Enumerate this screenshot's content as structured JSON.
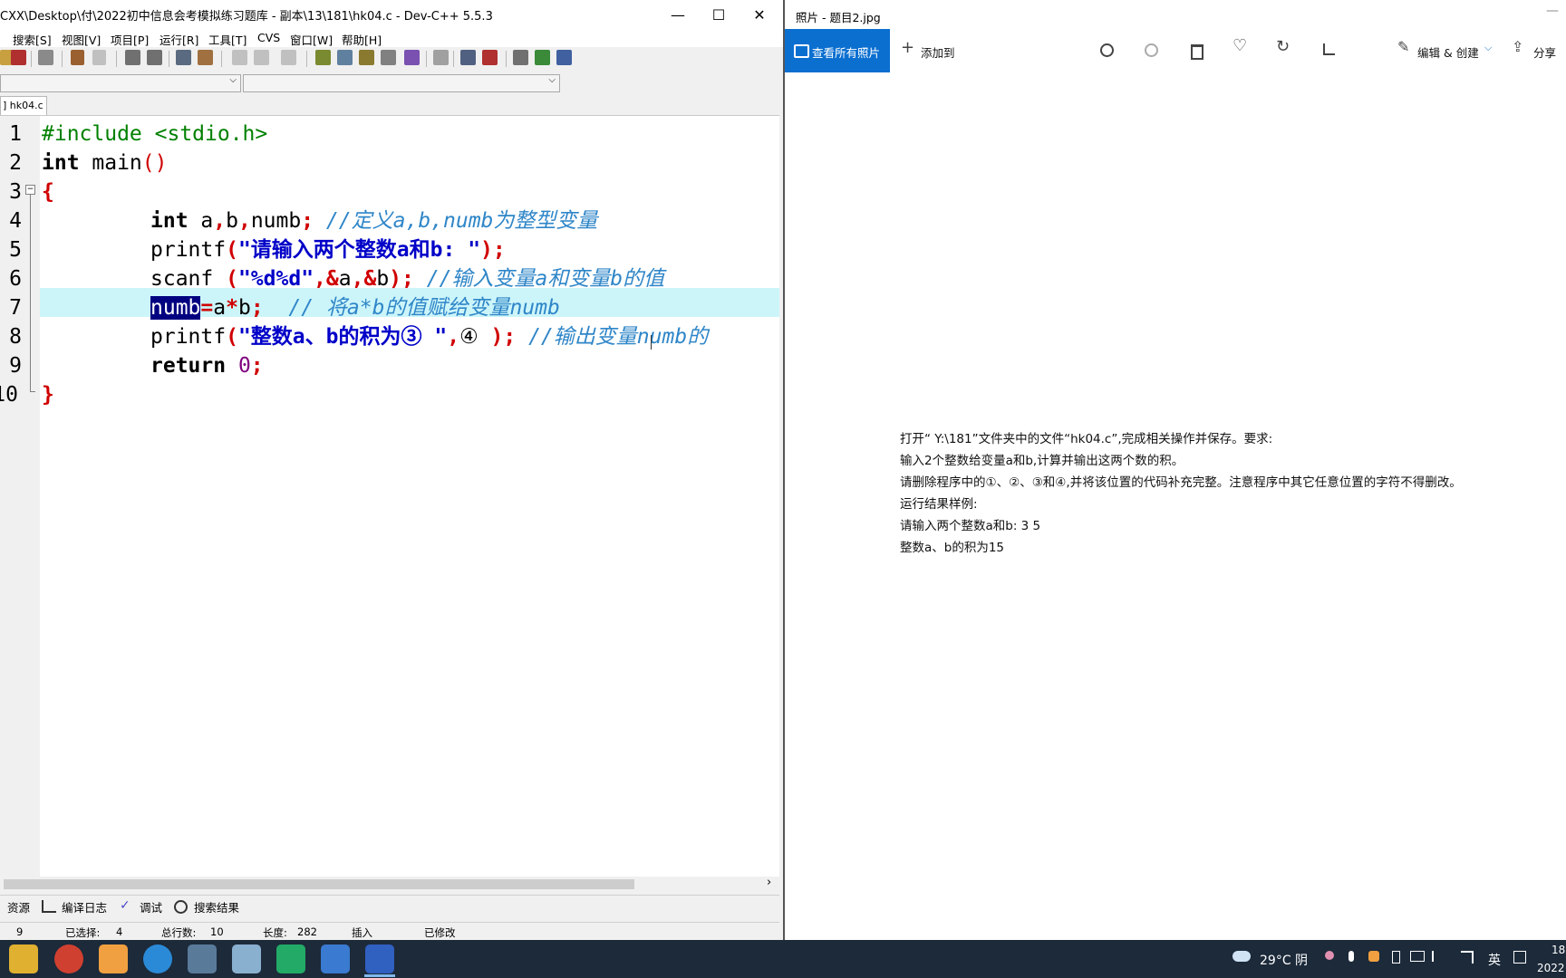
{
  "devcpp": {
    "title": "CXX\\Desktop\\付\\2022初中信息会考模拟练习题库 - 副本\\13\\181\\hk04.c - Dev-C++ 5.5.3",
    "minimize": "—",
    "maximize": "☐",
    "close": "✕",
    "menu": [
      "搜索[S]",
      "视图[V]",
      "项目[P]",
      "运行[R]",
      "工具[T]",
      "CVS",
      "窗口[W]",
      "帮助[H]"
    ],
    "combo_arrow": "⌵",
    "file_tab": "] hk04.c",
    "line_numbers": [
      "1",
      "2",
      "3",
      "4",
      "5",
      "6",
      "7",
      "8",
      "9",
      "10"
    ],
    "fold_marker": "−",
    "code": {
      "l1": "#include <stdio.h>",
      "l2_kw": "int",
      "l2_rest": " main",
      "l2_paren": "()",
      "l3": "{",
      "l4_kw": "int",
      "l4_vars": " a",
      "l4_c1": ",",
      "l4_b": "b",
      "l4_c2": ",",
      "l4_numb": "numb",
      "l4_semi": ";",
      "l4_cmt": " //定义a,b,numb为整型变量",
      "l5_fn": "printf",
      "l5_open": "(",
      "l5_str": "\"请输入两个整数a和b: \"",
      "l5_close": ");",
      "l6_fn": "scanf ",
      "l6_open": "(",
      "l6_str": "\"%d%d\"",
      "l6_c1": ",&",
      "l6_a": "a",
      "l6_c2": ",&",
      "l6_b": "b",
      "l6_close": ");",
      "l6_cmt": " //输入变量a和变量b的值",
      "l7_sel": "numb",
      "l7_eq": "=",
      "l7_a": "a",
      "l7_mul": "*",
      "l7_b": "b",
      "l7_semi": ";",
      "l7_cmt": "  // 将a*b的值赋给变量numb",
      "l8_fn": "printf",
      "l8_open": "(",
      "l8_str": "\"整数a、b的积为③ \"",
      "l8_comma": ",",
      "l8_blank": "④ ",
      "l8_close": ");",
      "l8_cmt": " //输出变量numb的",
      "l9_kw": "return",
      "l9_num": " 0",
      "l9_semi": ";",
      "l10": "}"
    },
    "scroll_right": "›",
    "bottom_tabs": [
      "资源",
      "编译日志",
      "调试",
      "搜索结果"
    ],
    "status": {
      "line_value": "9",
      "selected_label": "已选择:",
      "selected_value": "4",
      "total_label": "总行数:",
      "total_value": "10",
      "length_label": "长度:",
      "length_value": "282",
      "mode": "插入",
      "modified": "已修改"
    }
  },
  "photos": {
    "title": "照片 - 题目2.jpg",
    "minimize": "—",
    "view_all": "查看所有照片",
    "add_to": "添加到",
    "edit_create": "编辑 & 创建",
    "share": "分享",
    "document_lines": [
      "打开“ Y:\\181”文件夹中的文件“hk04.c”,完成相关操作并保存。要求:",
      "输入2个整数给变量a和b,计算并输出这两个数的积。",
      "请删除程序中的①、②、③和④,并将该位置的代码补充完整。注意程序中其它任意位置的字符不得删改。",
      "运行结果样例:",
      "请输入两个整数a和b: 3 5",
      "整数a、b的积为15"
    ]
  },
  "taskbar": {
    "weather": "29°C 阴",
    "ime": "英",
    "time": "18",
    "date": "2022"
  }
}
